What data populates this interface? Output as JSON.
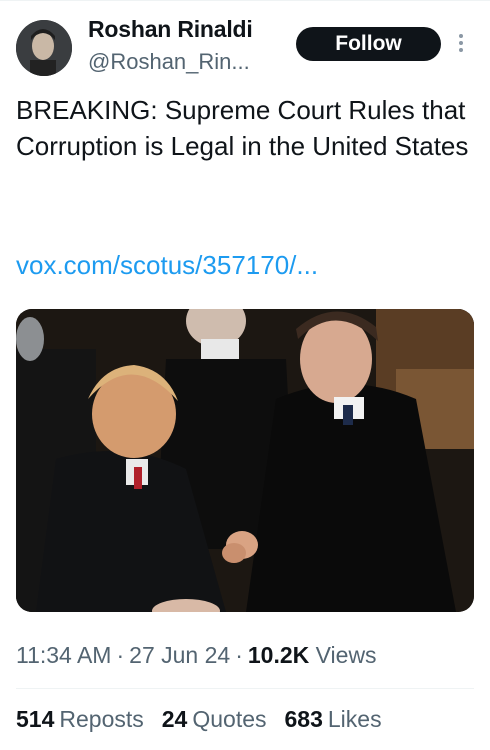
{
  "tweet": {
    "author_name": "Roshan Rinaldi",
    "author_handle": "@Roshan_Rin...",
    "follow_label": "Follow",
    "text": "BREAKING: Supreme Court Rules that Corruption is Legal in the United States",
    "link": "vox.com/scotus/357170/...",
    "time": "11:34 AM",
    "date": "27 Jun 24",
    "views_count": "10.2K",
    "views_label": "Views",
    "reposts_count": "514",
    "reposts_label": "Reposts",
    "quotes_count": "24",
    "quotes_label": "Quotes",
    "likes_count": "683",
    "likes_label": "Likes",
    "separator": "·"
  },
  "icons": {
    "more": "more-vertical-icon"
  },
  "colors": {
    "text": "#0f1419",
    "secondary": "#536471",
    "link": "#1d9bf0",
    "button": "#0f1419"
  }
}
